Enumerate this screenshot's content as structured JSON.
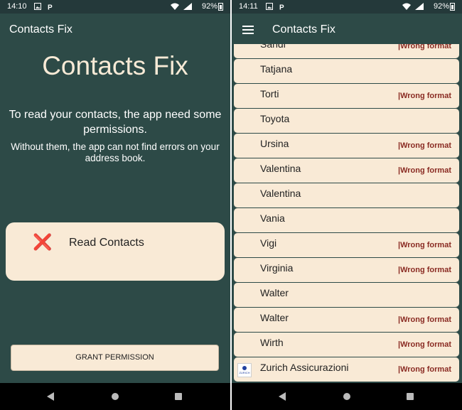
{
  "left": {
    "status": {
      "time": "14:10",
      "battery": "92%"
    },
    "toolbar_title": "Contacts Fix",
    "big_title": "Contacts Fix",
    "lead": "To read your contacts, the app need some permissions.",
    "sub": "Without them, the app can not find errors on your address book.",
    "permission": {
      "icon": "cross-icon",
      "symbol": "❌",
      "label": "Read Contacts"
    },
    "grant_button": "GRANT PERMISSION"
  },
  "right": {
    "status": {
      "time": "14:11",
      "battery": "92%"
    },
    "toolbar_title": "Contacts Fix",
    "contacts": [
      {
        "name": "Sandi",
        "status": "|Wrong format"
      },
      {
        "name": "Tatjana",
        "status": ""
      },
      {
        "name": "Torti",
        "status": "|Wrong format"
      },
      {
        "name": "Toyota",
        "status": ""
      },
      {
        "name": "Ursina",
        "status": "|Wrong format"
      },
      {
        "name": "Valentina",
        "status": "|Wrong format"
      },
      {
        "name": "Valentina",
        "status": ""
      },
      {
        "name": "Vania",
        "status": ""
      },
      {
        "name": "Vigi",
        "status": "|Wrong format"
      },
      {
        "name": "Virginia",
        "status": "|Wrong format"
      },
      {
        "name": "Walter",
        "status": ""
      },
      {
        "name": "Walter",
        "status": "|Wrong format"
      },
      {
        "name": "Wirth",
        "status": "|Wrong format"
      },
      {
        "name": "Zurich Assicurazioni",
        "status": "|Wrong format",
        "avatar": "ZURICH"
      }
    ]
  },
  "colors": {
    "background": "#2d4a47",
    "card": "#f9ead6",
    "error": "#8a2b23",
    "cross": "#e02424"
  }
}
